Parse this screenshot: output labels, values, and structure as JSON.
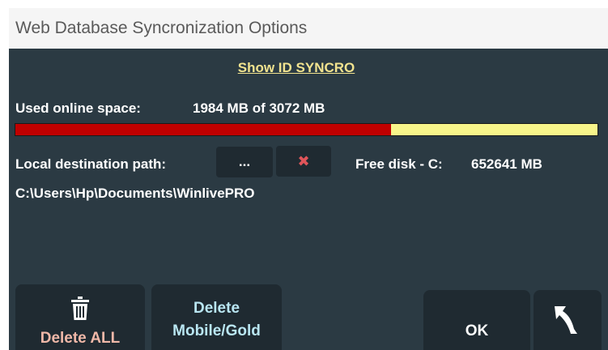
{
  "window": {
    "title": "Web Database Syncronization Options"
  },
  "show_id_link": "Show ID SYNCRO",
  "online_space": {
    "label": "Used online space:",
    "value_text": "1984 MB of 3072 MB",
    "used_mb": 1984,
    "total_mb": 3072,
    "used_fraction": 0.646,
    "used_color": "#c00000",
    "free_color": "#f8f58a"
  },
  "local_path": {
    "label": "Local destination path:",
    "browse_label": "...",
    "clear_icon": "close-icon",
    "path": "C:\\Users\\Hp\\Documents\\WinlivePRO"
  },
  "free_disk": {
    "label": "Free disk - C:",
    "value": "652641 MB"
  },
  "buttons": {
    "delete_all": "Delete ALL",
    "delete_all_icon": "trash-icon",
    "delete_mobile_line1": "Delete",
    "delete_mobile_line2": "Mobile/Gold",
    "ok": "OK",
    "back_icon": "back-arrow-icon"
  },
  "colors": {
    "background": "#2b3a43",
    "button": "#1f2a31",
    "link": "#f2e38f",
    "delete_all_text": "#f0b8a8",
    "delete_mobile_text": "#b9e6f2"
  }
}
